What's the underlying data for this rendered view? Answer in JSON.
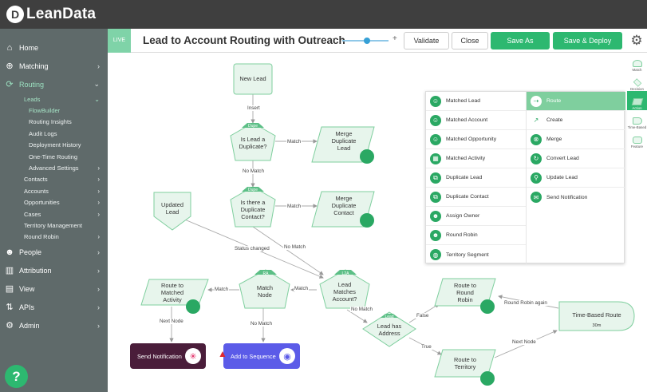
{
  "app": {
    "logo_mark": "D",
    "logo_text": "LeanData"
  },
  "sidebar": {
    "items": [
      {
        "label": "Home",
        "icon": "home-icon"
      },
      {
        "label": "Matching",
        "icon": "crosshair-icon"
      },
      {
        "label": "Routing",
        "icon": "routing-icon"
      },
      {
        "label": "People",
        "icon": "people-icon"
      },
      {
        "label": "Attribution",
        "icon": "bar-chart-icon"
      },
      {
        "label": "View",
        "icon": "view-icon"
      },
      {
        "label": "APIs",
        "icon": "api-icon"
      },
      {
        "label": "Admin",
        "icon": "gear-icon"
      }
    ],
    "routing_sub": {
      "leads": "Leads",
      "leads_children": [
        "FlowBuilder",
        "Routing Insights",
        "Audit Logs",
        "Deployment History",
        "One-Time Routing",
        "Advanced Settings"
      ],
      "others": [
        "Contacts",
        "Accounts",
        "Opportunities",
        "Cases",
        "Territory Management",
        "Round Robin"
      ]
    },
    "help_label": "?"
  },
  "toolbar": {
    "live_badge": "LIVE",
    "title": "Lead to Account Routing with Outreach",
    "zoom_minus": "–",
    "zoom_plus": "+",
    "validate": "Validate",
    "close": "Close",
    "save_as": "Save As",
    "save_deploy": "Save & Deploy",
    "zoom_level": 0.6
  },
  "right_panel": [
    {
      "label": "Match",
      "selected": false
    },
    {
      "label": "Decision",
      "selected": false
    },
    {
      "label": "Action",
      "selected": true
    },
    {
      "label": "Time-Based",
      "selected": false
    },
    {
      "label": "Feature",
      "selected": false
    }
  ],
  "palette": {
    "left": [
      "Matched Lead",
      "Matched Account",
      "Matched Opportunity",
      "Matched Activity",
      "Duplicate Lead",
      "Duplicate Contact",
      "Assign Owner",
      "Round Robin",
      "Territory Segment"
    ],
    "right": [
      "Route",
      "Create",
      "Merge",
      "Convert Lead",
      "Update Lead",
      "Send Notification"
    ],
    "selected": "Route"
  },
  "flow": {
    "nodes": {
      "new_lead": "New Lead",
      "updated_lead": "Updated\nLead",
      "dupe1_badge": "Dupe",
      "dupe1": "Is Lead a\nDuplicate?",
      "dupe2_badge": "Dupe",
      "dupe2": "Is there a\nDuplicate\nContact?",
      "merge_lead": "Merge\nDuplicate\nLead",
      "merge_contact": "Merge\nDuplicate\nContact",
      "l2a_badge": "L2A",
      "l2a": "Lead\nMatches\nAccount?",
      "ra_badge": "RA",
      "match_node": "Match\nNode",
      "route_activity": "Route to\nMatched\nActivity",
      "lead_badge": "Lead",
      "lead_address": "Lead has\nAddress",
      "rr": "Route to\nRound\nRobin",
      "territory": "Route to\nTerritory",
      "time_based": "Time-Based Route",
      "time_based_sub": "30m",
      "send_notification": "Send Notification",
      "add_sequence": "Add to Sequence"
    },
    "edges": {
      "insert": "Insert",
      "match1": "Match",
      "no_match1": "No Match",
      "match2": "Match",
      "status_changed": "Status changed",
      "no_match2": "No Match",
      "match3": "Match",
      "match4": "Match",
      "no_match3": "No Match",
      "false": "False",
      "true": "True",
      "next_node1": "Next Node",
      "no_match4": "No Match",
      "round_robin_again": "Round Robin again",
      "next_node2": "Next Node"
    }
  },
  "colors": {
    "accent": "#2db870",
    "node_fill": "#e7f5ec",
    "node_stroke": "#7fcf9e",
    "sidebar": "#5f6a6a",
    "topbar": "#3f3f3f",
    "notify": "#4a1d3a",
    "sequence": "#5b5be8"
  }
}
